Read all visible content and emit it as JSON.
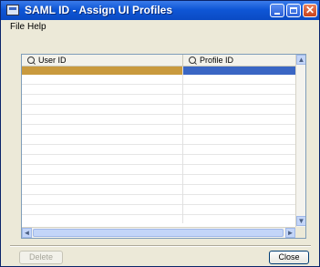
{
  "window": {
    "title": "SAML ID - Assign UI Profiles",
    "controls": {
      "minimize": "minimize",
      "maximize": "maximize",
      "close": "✕"
    }
  },
  "menu": {
    "items": [
      "File",
      "Help"
    ]
  },
  "grid": {
    "columns": [
      "User ID",
      "Profile ID"
    ],
    "rows": [
      {
        "user_id": "",
        "profile_id": "",
        "selected": true
      }
    ],
    "colors": {
      "selected_user": "#C99A3E",
      "selected_profile": "#3A66C4"
    },
    "scroll": {
      "up": "▲",
      "down": "▼",
      "left": "◄",
      "right": "►"
    }
  },
  "buttons": {
    "delete": "Delete",
    "close": "Close"
  }
}
